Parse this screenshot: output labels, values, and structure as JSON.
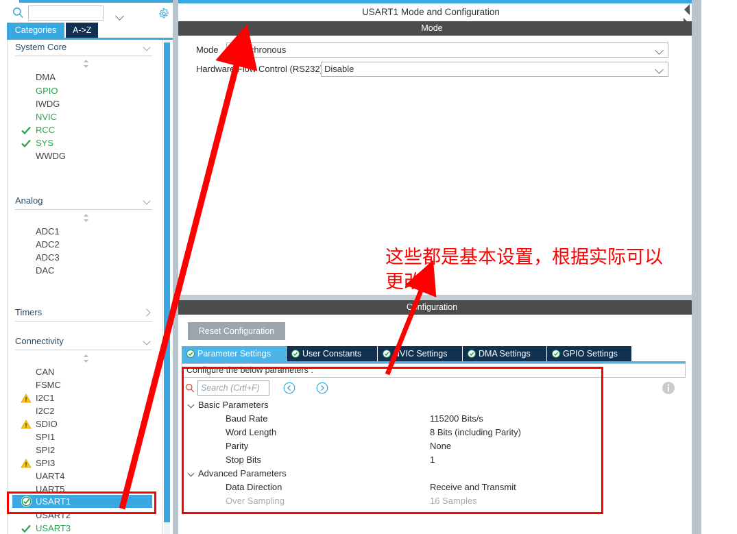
{
  "sidebar": {
    "search": {
      "value": "",
      "placeholder": ""
    },
    "gear_icon": "gear-icon",
    "tabs": [
      {
        "label": "Categories",
        "active": true
      },
      {
        "label": "A->Z",
        "active": false
      }
    ],
    "groups": [
      {
        "label": "System Core",
        "expanded": true,
        "items": [
          {
            "label": "DMA",
            "state": "none"
          },
          {
            "label": "GPIO",
            "state": "green"
          },
          {
            "label": "IWDG",
            "state": "none"
          },
          {
            "label": "NVIC",
            "state": "green"
          },
          {
            "label": "RCC",
            "state": "check"
          },
          {
            "label": "SYS",
            "state": "check"
          },
          {
            "label": "WWDG",
            "state": "none"
          }
        ]
      },
      {
        "label": "Analog",
        "expanded": true,
        "items": [
          {
            "label": "ADC1",
            "state": "none"
          },
          {
            "label": "ADC2",
            "state": "none"
          },
          {
            "label": "ADC3",
            "state": "none"
          },
          {
            "label": "DAC",
            "state": "none"
          }
        ]
      },
      {
        "label": "Timers",
        "expanded": false,
        "items": []
      },
      {
        "label": "Connectivity",
        "expanded": true,
        "items": [
          {
            "label": "CAN",
            "state": "none"
          },
          {
            "label": "FSMC",
            "state": "none"
          },
          {
            "label": "I2C1",
            "state": "warn"
          },
          {
            "label": "I2C2",
            "state": "none"
          },
          {
            "label": "SDIO",
            "state": "warn"
          },
          {
            "label": "SPI1",
            "state": "none"
          },
          {
            "label": "SPI2",
            "state": "none"
          },
          {
            "label": "SPI3",
            "state": "warn"
          },
          {
            "label": "UART4",
            "state": "none"
          },
          {
            "label": "UART5",
            "state": "none"
          },
          {
            "label": "USART1",
            "state": "selected"
          },
          {
            "label": "USART2",
            "state": "none"
          },
          {
            "label": "USART3",
            "state": "check"
          }
        ]
      }
    ]
  },
  "right": {
    "panel_title": "USART1 Mode and Configuration",
    "mode_header": "Mode",
    "fields": [
      {
        "label": "Mode",
        "value": "Asynchronous"
      },
      {
        "label": "Hardware Flow Control (RS232)",
        "value": "Disable"
      }
    ],
    "config_header": "Configuration",
    "reset_button": "Reset Configuration",
    "tabs": [
      {
        "label": "Parameter Settings",
        "active": true
      },
      {
        "label": "User Constants",
        "active": false
      },
      {
        "label": "NVIC Settings",
        "active": false
      },
      {
        "label": "DMA Settings",
        "active": false
      },
      {
        "label": "GPIO Settings",
        "active": false
      }
    ],
    "param_hint": "Configure the below parameters :",
    "search": {
      "value": "",
      "placeholder": "Search (Crtl+F)"
    },
    "nav_prev_icon": "chevron-left-circle-icon",
    "nav_next_icon": "chevron-right-circle-icon",
    "info_icon": "info-icon",
    "tree": [
      {
        "type": "group",
        "label": "Basic Parameters",
        "expanded": true
      },
      {
        "type": "row",
        "name": "Baud Rate",
        "value": "115200 Bits/s",
        "dim": false
      },
      {
        "type": "row",
        "name": "Word Length",
        "value": "8 Bits (including Parity)",
        "dim": false
      },
      {
        "type": "row",
        "name": "Parity",
        "value": "None",
        "dim": false
      },
      {
        "type": "row",
        "name": "Stop Bits",
        "value": "1",
        "dim": false
      },
      {
        "type": "group",
        "label": "Advanced Parameters",
        "expanded": true
      },
      {
        "type": "row",
        "name": "Data Direction",
        "value": "Receive and Transmit",
        "dim": false
      },
      {
        "type": "row",
        "name": "Over Sampling",
        "value": "16 Samples",
        "dim": true
      }
    ]
  },
  "annotations": {
    "note_line1": "这些都是基本设置，根据实际可以",
    "note_line2": "更改",
    "color": "#ff0000"
  },
  "colors": {
    "accent_blue": "#3aa8e0",
    "tab_active": "#4cb4e7",
    "tab_inactive": "#12304f",
    "header_gray": "#4c4c4c",
    "annotation_red": "#ff0000",
    "green_text": "#2ca14f",
    "warn_yellow": "#f5c518"
  }
}
